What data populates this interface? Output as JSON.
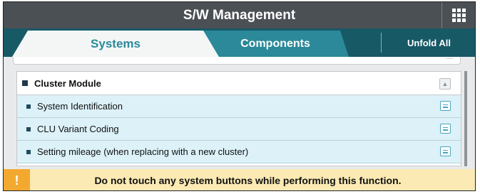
{
  "header": {
    "title": "S/W Management",
    "menu_icon": "grid-menu-icon"
  },
  "tabs": [
    {
      "label": "Systems",
      "active": true
    },
    {
      "label": "Components",
      "active": false
    }
  ],
  "toolbar": {
    "unfold_label": "Unfold All"
  },
  "module": {
    "title": "Cluster Module",
    "items": [
      {
        "label": "System Identification"
      },
      {
        "label": "CLU Variant Coding"
      },
      {
        "label": "Setting mileage (when replacing with a new cluster)"
      }
    ]
  },
  "warning": {
    "icon_text": "!",
    "message": "Do not touch any system buttons while performing this function."
  },
  "colors": {
    "title_bar": "#4b5055",
    "tab_bar": "#185966",
    "active_tab_text": "#2a8a9c",
    "inactive_tab": "#2b8999",
    "item_bg": "#dcf1f8",
    "warning_bg": "#fbeab3",
    "warning_icon": "#f3a92f"
  }
}
